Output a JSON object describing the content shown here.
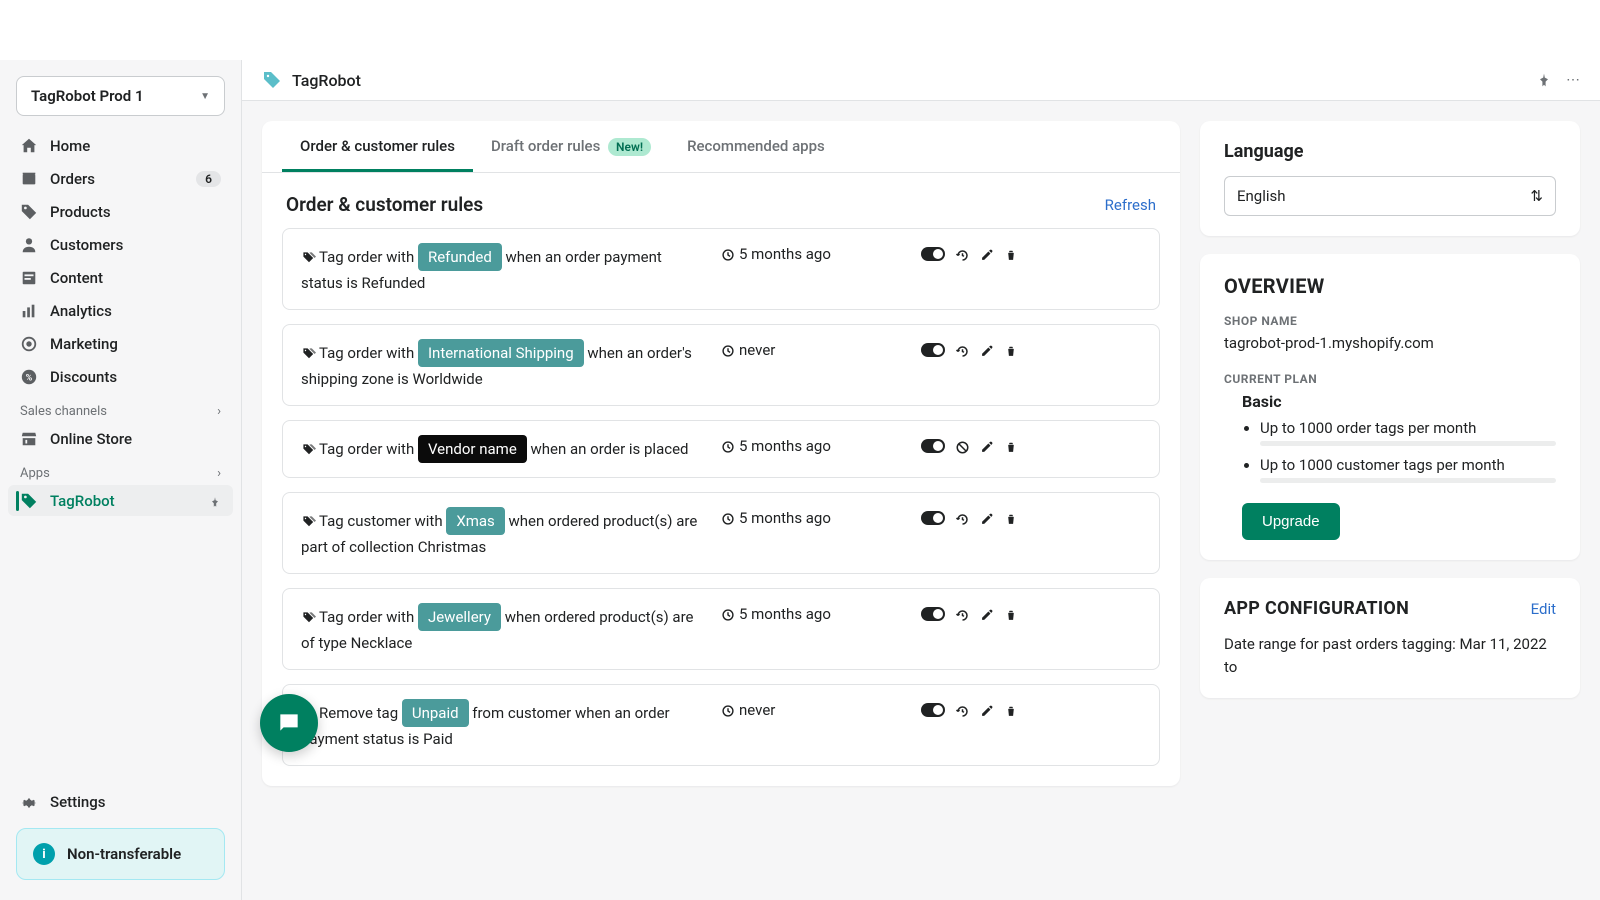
{
  "store_selector": {
    "label": "TagRobot Prod 1"
  },
  "sidebar": {
    "items": [
      {
        "label": "Home"
      },
      {
        "label": "Orders",
        "badge": "6"
      },
      {
        "label": "Products"
      },
      {
        "label": "Customers"
      },
      {
        "label": "Content"
      },
      {
        "label": "Analytics"
      },
      {
        "label": "Marketing"
      },
      {
        "label": "Discounts"
      }
    ],
    "section_channels": "Sales channels",
    "online_store": "Online Store",
    "section_apps": "Apps",
    "tagrobot": "TagRobot",
    "settings": "Settings",
    "non_transferable": "Non-transferable"
  },
  "topbar": {
    "title": "TagRobot"
  },
  "tabs": {
    "t1": "Order & customer rules",
    "t2": "Draft order rules",
    "t2_badge": "New!",
    "t3": "Recommended apps"
  },
  "rules_heading": "Order & customer rules",
  "refresh": "Refresh",
  "rules": [
    {
      "pre": "Tag order with ",
      "tag": "Refunded",
      "tag_class": "tag-teal",
      "post": " when an order payment status is Refunded",
      "time": "5 months ago",
      "alt_icon": false
    },
    {
      "pre": "Tag order with ",
      "tag": "International Shipping",
      "tag_class": "tag-teal",
      "post": " when an order's shipping zone is Worldwide",
      "time": "never",
      "alt_icon": false
    },
    {
      "pre": "Tag order with ",
      "tag": "Vendor name",
      "tag_class": "tag-black",
      "post": " when an order is placed",
      "time": "5 months ago",
      "alt_icon": true
    },
    {
      "pre": "Tag customer with ",
      "tag": "Xmas",
      "tag_class": "tag-teal",
      "post": " when ordered product(s) are part of collection Christmas",
      "time": "5 months ago",
      "alt_icon": false
    },
    {
      "pre": "Tag order with ",
      "tag": "Jewellery",
      "tag_class": "tag-teal",
      "post": " when ordered product(s) are of type Necklace",
      "time": "5 months ago",
      "alt_icon": false
    },
    {
      "pre": "Remove tag ",
      "tag": "Unpaid",
      "tag_class": "tag-teal",
      "post": " from customer when an order payment status is Paid",
      "time": "never",
      "alt_icon": false
    }
  ],
  "language": {
    "heading": "Language",
    "selected": "English"
  },
  "overview": {
    "heading": "OVERVIEW",
    "shop_name_label": "SHOP NAME",
    "shop_name": "tagrobot-prod-1.myshopify.com",
    "plan_label": "CURRENT PLAN",
    "plan_name": "Basic",
    "limit1": "Up to 1000 order tags per month",
    "limit2": "Up to 1000 customer tags per month",
    "upgrade": "Upgrade"
  },
  "appcfg": {
    "heading": "APP CONFIGURATION",
    "edit": "Edit",
    "text": "Date range for past orders tagging: Mar 11, 2022 to"
  }
}
